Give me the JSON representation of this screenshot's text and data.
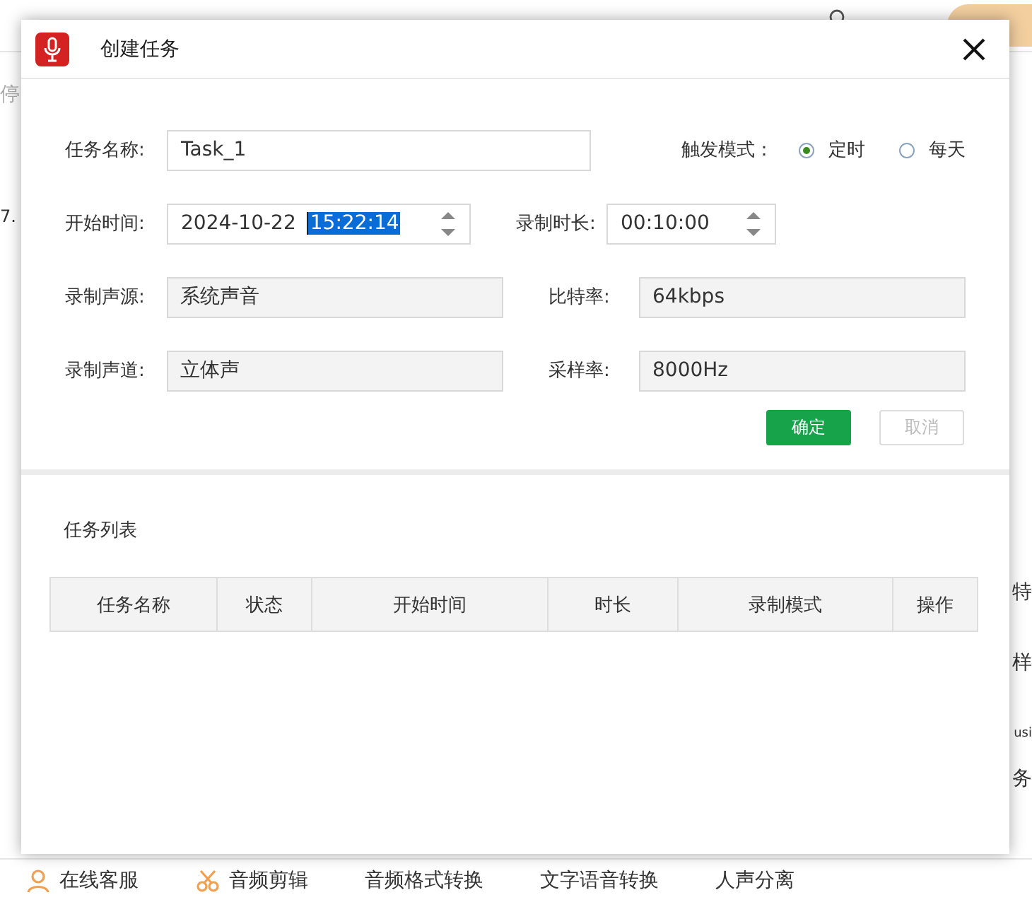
{
  "background": {
    "left_fragments": [
      "停",
      "7."
    ],
    "right_fragments": [
      "特",
      "样",
      "usi",
      "务"
    ],
    "bottom_tools": [
      {
        "label": "在线客服",
        "kind": "person"
      },
      {
        "label": "音频剪辑",
        "kind": "scissors"
      },
      {
        "label": "音频格式转换",
        "kind": "none"
      },
      {
        "label": "文字语音转换",
        "kind": "none"
      },
      {
        "label": "人声分离",
        "kind": "none"
      }
    ]
  },
  "dialog": {
    "title": "创建任务",
    "task_name": {
      "label": "任务名称:",
      "value": "Task_1"
    },
    "trigger_mode": {
      "label": "触发模式：",
      "options": [
        {
          "label": "定时",
          "selected": true
        },
        {
          "label": "每天",
          "selected": false
        }
      ]
    },
    "start_time": {
      "label": "开始时间:",
      "date": "2024-10-22",
      "time": "15:22:14",
      "time_highlighted": true
    },
    "duration": {
      "label": "录制时长:",
      "value": "00:10:00"
    },
    "readonly_fields": [
      {
        "label": "录制声源:",
        "value": "系统声音"
      },
      {
        "label": "比特率:",
        "value": "64kbps"
      },
      {
        "label": "录制声道:",
        "value": "立体声"
      },
      {
        "label": "采样率:",
        "value": "8000Hz"
      }
    ],
    "buttons": [
      {
        "label": "确定",
        "kind": "primary",
        "disabled": false
      },
      {
        "label": "取消",
        "kind": "secondary",
        "disabled": true
      }
    ],
    "task_list": {
      "title": "任务列表",
      "columns": [
        "任务名称",
        "状态",
        "开始时间",
        "时长",
        "录制模式",
        "操作"
      ]
    }
  }
}
